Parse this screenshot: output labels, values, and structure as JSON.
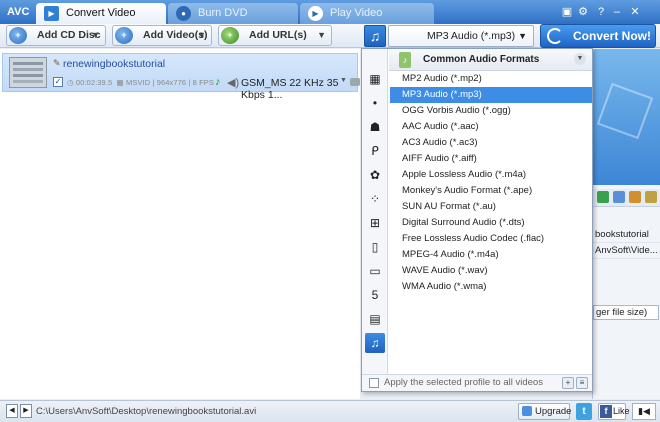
{
  "app": {
    "logo": "AVC",
    "tabs": [
      {
        "label": "Convert Video",
        "active": true,
        "icon": "convert-icon"
      },
      {
        "label": "Burn DVD",
        "active": false,
        "icon": "dvd-icon"
      },
      {
        "label": "Play Video",
        "active": false,
        "icon": "play-icon"
      }
    ],
    "window_buttons": {
      "skin": "▣",
      "settings": "⚙",
      "help": "?",
      "minimize": "–",
      "close": "✕"
    }
  },
  "toolbar": {
    "add_cd": "Add CD Disc",
    "add_videos": "Add Video(s)",
    "add_urls": "Add URL(s)",
    "profile_value": "MP3 Audio (*.mp3)",
    "convert_label": "Convert Now!"
  },
  "file": {
    "name": "renewingbookstutorial",
    "duration": "00:02:39.5",
    "codec": "MSVID",
    "resolution": "964x776",
    "fps": "8 FPS",
    "audio_track": "GSM_MS 22 KHz 35 Kbps 1..."
  },
  "right_panel": {
    "lines": [
      "bookstutorial",
      "AnvSoft\\Vide..."
    ],
    "select_value": "ger file size)"
  },
  "dropdown": {
    "header": "Common Audio Formats",
    "categories": [
      {
        "icon": "all-profiles-icon",
        "selected": false
      },
      {
        "icon": "apple-icon",
        "selected": false
      },
      {
        "icon": "android-icon",
        "selected": false
      },
      {
        "icon": "playstation-icon",
        "selected": false
      },
      {
        "icon": "huawei-icon",
        "selected": false
      },
      {
        "icon": "blackberry-icon",
        "selected": false
      },
      {
        "icon": "windows-icon",
        "selected": false
      },
      {
        "icon": "mobile-phone-icon",
        "selected": false
      },
      {
        "icon": "tv-icon",
        "selected": false
      },
      {
        "icon": "html5-icon",
        "selected": false
      },
      {
        "icon": "film-icon",
        "selected": false
      },
      {
        "icon": "music-note-icon",
        "selected": true
      }
    ],
    "formats": [
      "MP2 Audio (*.mp2)",
      "MP3 Audio (*.mp3)",
      "OGG Vorbis Audio (*.ogg)",
      "AAC Audio (*.aac)",
      "AC3 Audio (*.ac3)",
      "AIFF Audio (*.aiff)",
      "Apple Lossless Audio (*.m4a)",
      "Monkey's Audio Format (*.ape)",
      "SUN AU Format (*.au)",
      "Digital Surround Audio (*.dts)",
      "Free Lossless Audio Codec (.flac)",
      "MPEG-4 Audio (*.m4a)",
      "WAVE Audio (*.wav)",
      "WMA Audio (*.wma)"
    ],
    "selected_format": "MP3 Audio (*.mp3)",
    "apply_all": "Apply the selected profile to all videos"
  },
  "statusbar": {
    "path": "C:\\Users\\AnvSoft\\Desktop\\renewingbookstutorial.avi",
    "upgrade": "Upgrade",
    "twitter": "t",
    "like": "Like",
    "fb": "f"
  },
  "colors": {
    "accent": "#2f7fd6",
    "selection": "#3d8de6",
    "titlebar": "#3a7cd0"
  }
}
